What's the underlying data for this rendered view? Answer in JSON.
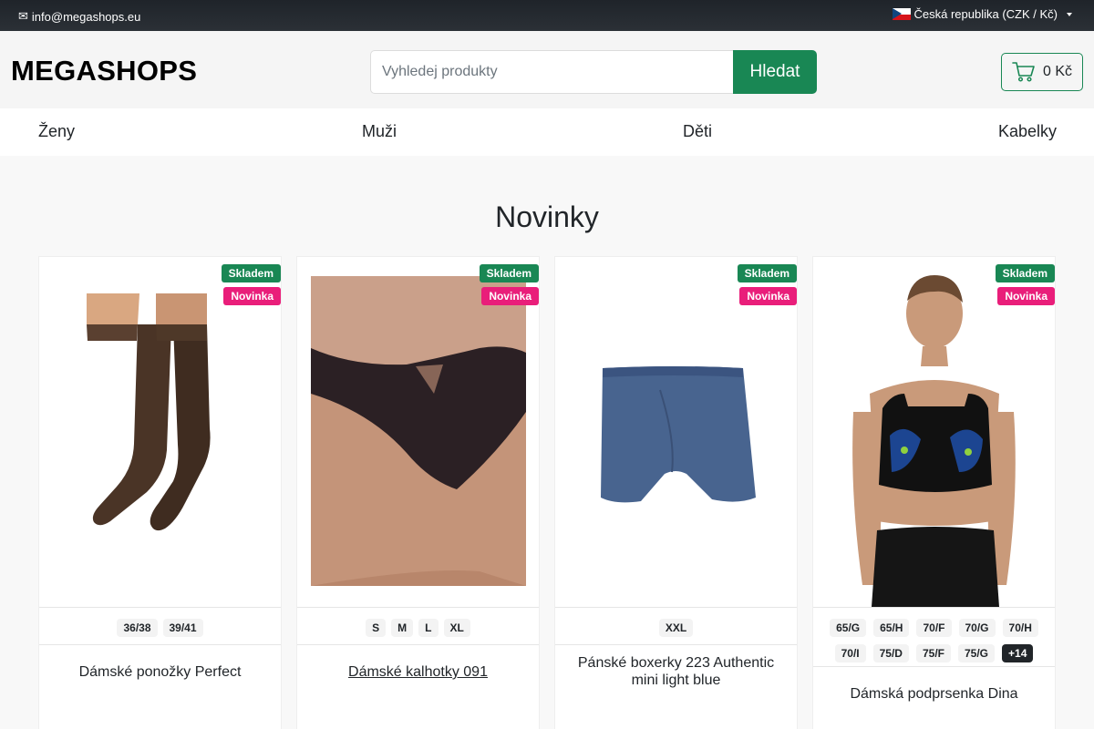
{
  "topbar": {
    "email": "info@megashops.eu",
    "region": "Česká republika (CZK / Kč)"
  },
  "header": {
    "logo": "MEGASHOPS",
    "search_placeholder": "Vyhledej produkty",
    "search_button": "Hledat",
    "cart_total": "0 Kč"
  },
  "nav": {
    "items": [
      "Ženy",
      "Muži",
      "Děti",
      "Kabelky"
    ]
  },
  "section": {
    "title": "Novinky"
  },
  "products": [
    {
      "badge_stock": "Skladem",
      "badge_new": "Novinka",
      "image": "brown-socks",
      "sizes": [
        "36/38",
        "39/41"
      ],
      "name": "Dámské ponožky Perfect"
    },
    {
      "badge_stock": "Skladem",
      "badge_new": "Novinka",
      "image": "black-lace-panties",
      "sizes": [
        "S",
        "M",
        "L",
        "XL"
      ],
      "name": "Dámské kalhotky 091"
    },
    {
      "badge_stock": "Skladem",
      "badge_new": "Novinka",
      "image": "blue-boxer-briefs",
      "sizes": [
        "XXL"
      ],
      "name": "Pánské boxerky 223 Authentic mini light blue"
    },
    {
      "badge_stock": "Skladem",
      "badge_new": "Novinka",
      "image": "sports-bra-model",
      "sizes": [
        "65/G",
        "65/H",
        "70/F",
        "70/G",
        "70/H",
        "70/I",
        "75/D",
        "75/F",
        "75/G"
      ],
      "sizes_more": "+14",
      "name": "Dámská podprsenka Dina"
    }
  ],
  "colors": {
    "accent_green": "#198754",
    "badge_pink": "#e91e7a",
    "topbar_dark": "#212529"
  }
}
